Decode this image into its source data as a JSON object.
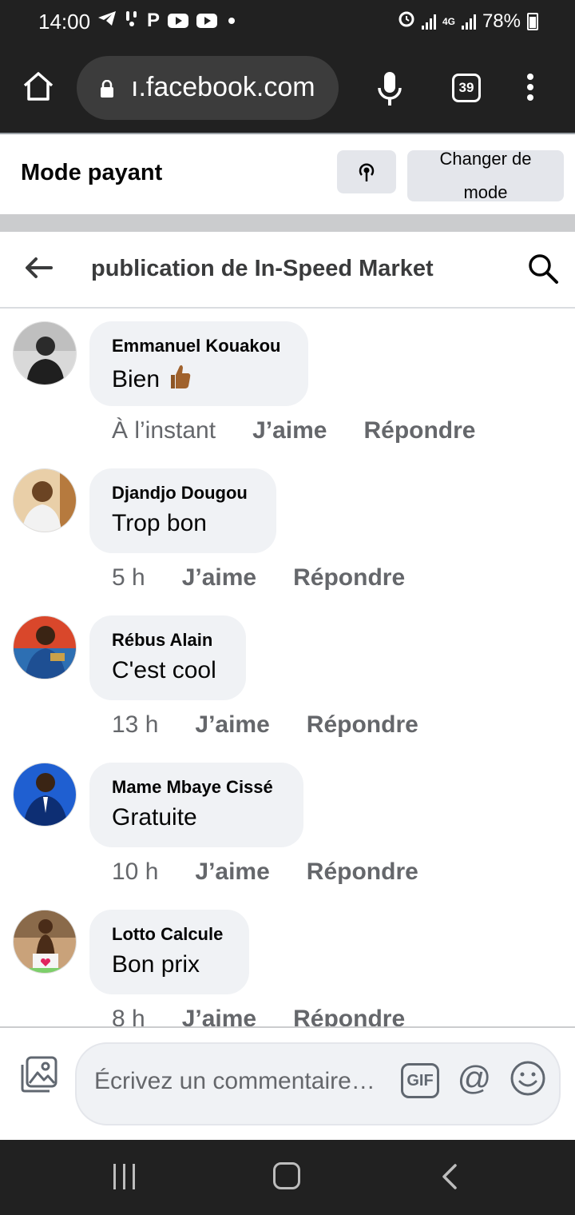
{
  "status_bar": {
    "time": "14:00",
    "battery": "78%",
    "network": "4G"
  },
  "browser": {
    "url": "ı.facebook.com",
    "tab_count": "39"
  },
  "mode_banner": {
    "title": "Mode payant",
    "change_mode_label": "Changer de mode"
  },
  "header": {
    "title": "publication de In-Speed Market"
  },
  "comments": [
    {
      "author": "Emmanuel Kouakou",
      "text": "Bien",
      "emoji": "thumbs-up",
      "time": "À l’instant",
      "like": "J’aime",
      "reply": "Répondre"
    },
    {
      "author": "Djandjo Dougou",
      "text": "Trop bon",
      "time": "5 h",
      "like": "J’aime",
      "reply": "Répondre"
    },
    {
      "author": "Rébus Alain",
      "text": "C'est cool",
      "time": "13 h",
      "like": "J’aime",
      "reply": "Répondre"
    },
    {
      "author": "Mame Mbaye Cissé",
      "text": "Gratuite",
      "time": "10 h",
      "like": "J’aime",
      "reply": "Répondre"
    },
    {
      "author": "Lotto Calcule",
      "text": "Bon prix",
      "time": "8 h",
      "like": "J’aime",
      "reply": "Répondre"
    }
  ],
  "composer": {
    "placeholder": "Écrivez un commentaire…",
    "gif_label": "GIF",
    "at_label": "@"
  },
  "colors": {
    "system_bar": "#212121",
    "bubble": "#f0f2f5",
    "muted_text": "#65676b",
    "button_bg": "#e4e6eb"
  }
}
